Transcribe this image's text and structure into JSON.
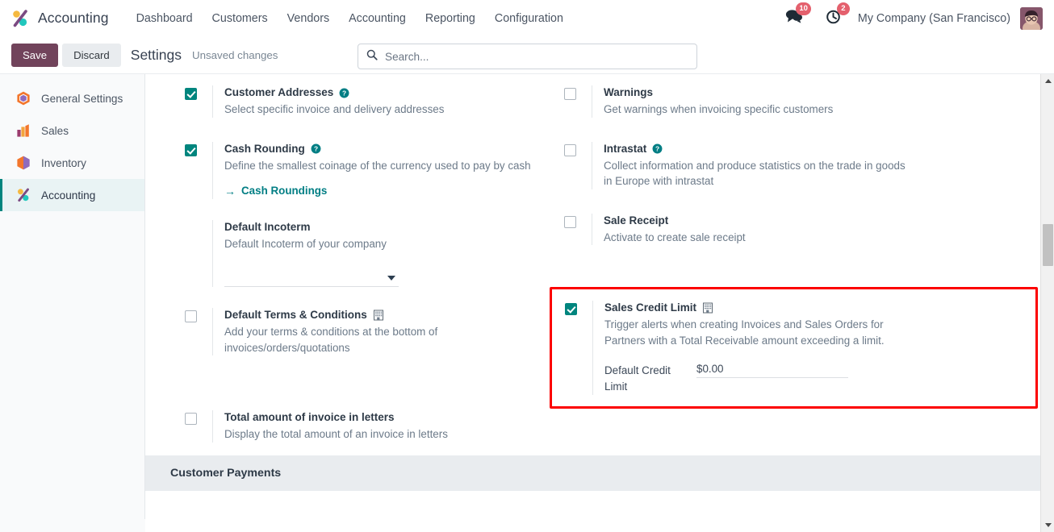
{
  "navbar": {
    "brand": "Accounting",
    "brand_logo_icon": "odoo-accounting-logo-icon",
    "menu": [
      {
        "label": "Dashboard"
      },
      {
        "label": "Customers"
      },
      {
        "label": "Vendors"
      },
      {
        "label": "Accounting"
      },
      {
        "label": "Reporting"
      },
      {
        "label": "Configuration"
      }
    ],
    "messages_icon": "chat-bubble-icon",
    "messages_count": "10",
    "activities_icon": "clock-activity-icon",
    "activities_count": "2",
    "company": "My Company (San Francisco)",
    "avatar_icon": "user-avatar"
  },
  "control_panel": {
    "save_label": "Save",
    "discard_label": "Discard",
    "title": "Settings",
    "dirty_note": "Unsaved changes",
    "search_icon": "search-icon",
    "search_placeholder": "Search...",
    "search_value": ""
  },
  "sidebar": {
    "items": [
      {
        "label": "General Settings",
        "icon": "general-settings-app-icon",
        "active": false
      },
      {
        "label": "Sales",
        "icon": "sales-app-icon",
        "active": false
      },
      {
        "label": "Inventory",
        "icon": "inventory-app-icon",
        "active": false
      },
      {
        "label": "Accounting",
        "icon": "accounting-app-icon",
        "active": true
      }
    ]
  },
  "settings": {
    "left": {
      "customer_addresses": {
        "title": "Customer Addresses",
        "desc": "Select specific invoice and delivery addresses",
        "checked": true,
        "help_icon": "help-circle-icon"
      },
      "cash_rounding": {
        "title": "Cash Rounding",
        "desc": "Define the smallest coinage of the currency used to pay by cash",
        "checked": true,
        "help_icon": "help-circle-icon",
        "link_label": "Cash Roundings",
        "link_icon": "arrow-right-icon"
      },
      "default_incoterm": {
        "title": "Default Incoterm",
        "desc": "Default Incoterm of your company",
        "select_value": "",
        "caret_icon": "chevron-down-icon"
      },
      "default_terms": {
        "title": "Default Terms & Conditions",
        "desc": "Add your terms & conditions at the bottom of invoices/orders/quotations",
        "checked": false,
        "company_icon": "building-company-icon"
      },
      "total_in_letters": {
        "title": "Total amount of invoice in letters",
        "desc": "Display the total amount of an invoice in letters",
        "checked": false
      }
    },
    "right": {
      "warnings": {
        "title": "Warnings",
        "desc": "Get warnings when invoicing specific customers",
        "checked": false
      },
      "intrastat": {
        "title": "Intrastat",
        "desc": "Collect information and produce statistics on the trade in goods in Europe with intrastat",
        "checked": false,
        "help_icon": "help-circle-icon"
      },
      "sale_receipt": {
        "title": "Sale Receipt",
        "desc": "Activate to create sale receipt",
        "checked": false
      },
      "sales_credit_limit": {
        "title": "Sales Credit Limit",
        "desc": "Trigger alerts when creating Invoices and Sales Orders for Partners with a Total Receivable amount exceeding a limit.",
        "checked": true,
        "company_icon": "building-company-icon",
        "highlight_color": "#fc0000",
        "field_label": "Default Credit Limit",
        "field_value": "$0.00"
      }
    },
    "section_customer_payments": "Customer Payments"
  },
  "scrollbar": {
    "up_icon": "scroll-up-arrow-icon",
    "down_icon": "scroll-down-arrow-icon",
    "thumb_icon": "scrollbar-thumb"
  },
  "colors": {
    "accent_teal": "#00857e",
    "save_purple": "#71435b",
    "badge_red": "#e4606d",
    "highlight_red": "#fc0000"
  }
}
